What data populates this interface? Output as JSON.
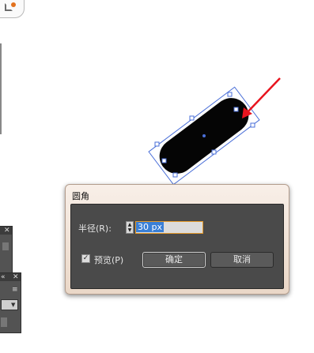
{
  "dialog": {
    "title": "圆角",
    "radius_label": "半径(R):",
    "radius_value": "30 px",
    "preview_label": "预览(P)",
    "preview_checked": true,
    "ok_label": "确定",
    "cancel_label": "取消"
  },
  "icons": {
    "check": "✓",
    "close": "✕",
    "stepper_up": "▲",
    "stepper_down": "▼",
    "panel_collapse": "«",
    "panel_menu": "≡",
    "dropdown_arrow": "▼"
  },
  "colors": {
    "accent_arrow": "#e8141e",
    "selection_blue": "#3a7fd6",
    "dialog_body": "#4a4a4a",
    "field_focus": "#e49a2a"
  }
}
